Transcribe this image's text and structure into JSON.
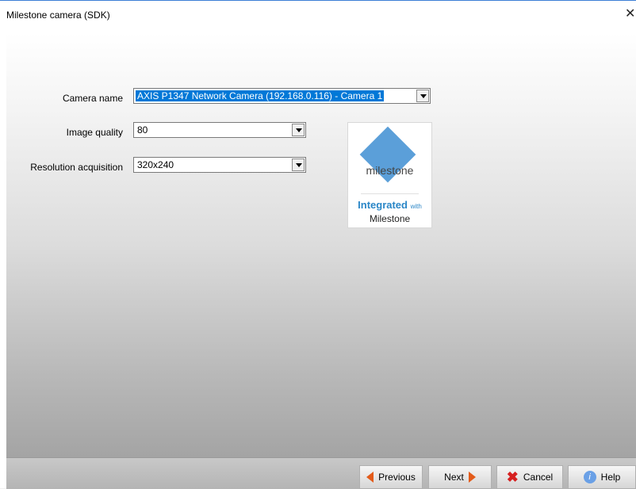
{
  "window": {
    "title": "Milestone camera (SDK)",
    "close_glyph": "✕"
  },
  "form": {
    "camera_name": {
      "label": "Camera name",
      "value": "AXIS P1347 Network Camera (192.168.0.116) - Camera 1"
    },
    "image_quality": {
      "label": "Image quality",
      "value": "80"
    },
    "resolution": {
      "label": "Resolution acquisition",
      "value": "320x240"
    }
  },
  "logo": {
    "wordmark": "milestone",
    "integrated": "Integrated",
    "with": "with",
    "brand": "Milestone",
    "diamond_color": "#5b9fd9"
  },
  "buttons": {
    "previous": "Previous",
    "next": "Next",
    "cancel": "Cancel",
    "help": "Help"
  },
  "icons": {
    "previous": "left-arrow-icon",
    "next": "right-arrow-icon",
    "cancel": "red-x-icon",
    "help": "help-icon"
  }
}
